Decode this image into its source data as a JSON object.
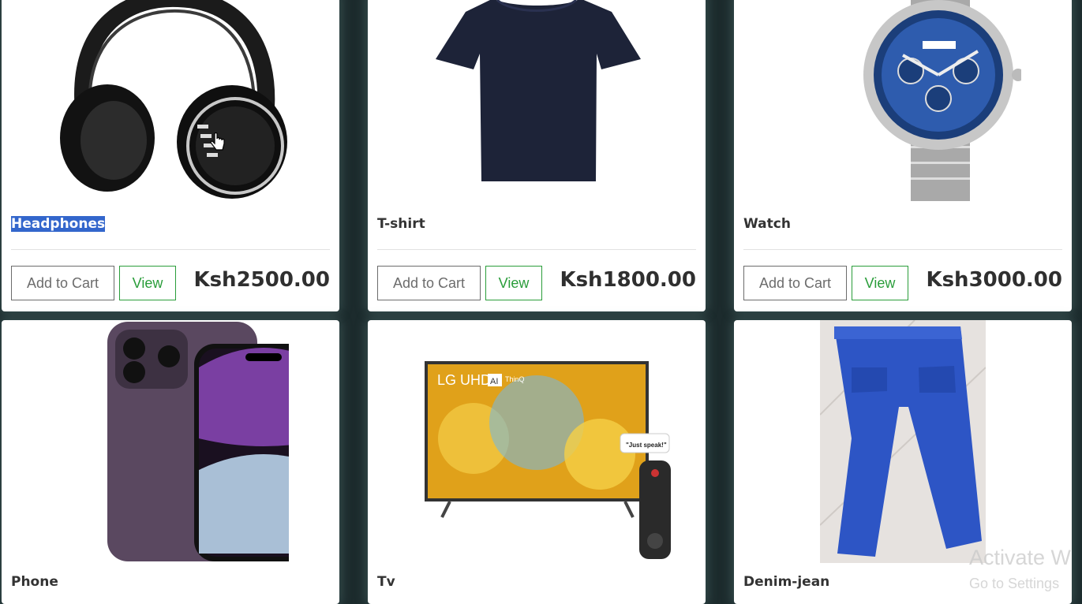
{
  "products": [
    {
      "name": "Headphones",
      "price": "Ksh2500.00",
      "add_to_cart": "Add to Cart",
      "view": "View",
      "image": "headphones-image"
    },
    {
      "name": "T-shirt",
      "price": "Ksh1800.00",
      "add_to_cart": "Add to Cart",
      "view": "View",
      "image": "tshirt-image"
    },
    {
      "name": "Watch",
      "price": "Ksh3000.00",
      "add_to_cart": "Add to Cart",
      "view": "View",
      "image": "watch-image"
    },
    {
      "name": "Phone",
      "image": "phone-image"
    },
    {
      "name": "Tv",
      "image": "tv-image",
      "tv_brand_text": "LG UHD",
      "tv_ai_badge": "AI",
      "tv_thinq": "ThinQ",
      "speech_bubble": "\"Just speak!\""
    },
    {
      "name": "Denim-jean",
      "image": "jeans-image"
    }
  ],
  "watermark": {
    "line1": "Activate W",
    "line2": "Go to Settings"
  },
  "colors": {
    "page_bg": "#1c2b2d",
    "view_green": "#2a9d3a",
    "selection": "#3366cc"
  }
}
